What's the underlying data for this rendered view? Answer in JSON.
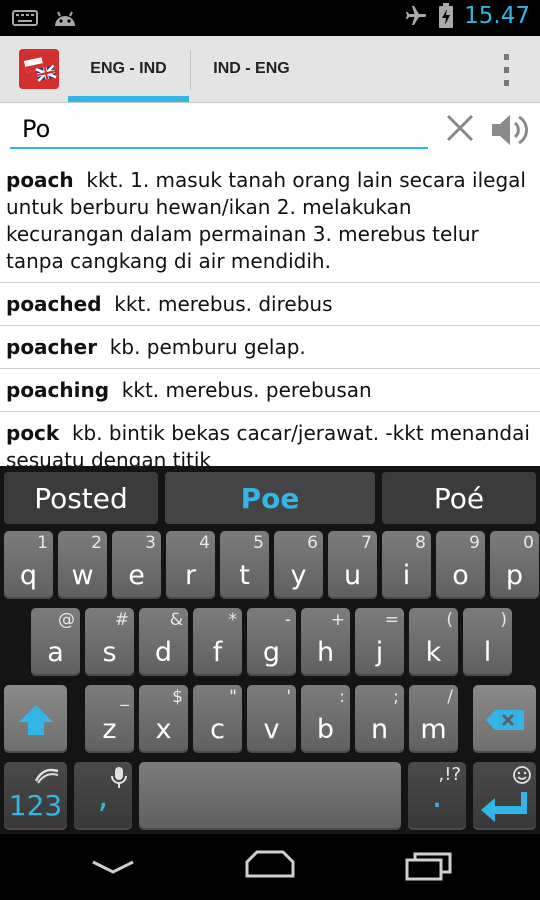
{
  "status_bar": {
    "time": "15.47",
    "icons": [
      "keyboard-icon",
      "android-debug-icon",
      "airplane-icon",
      "battery-charging-icon"
    ]
  },
  "action_bar": {
    "app_icon": "flag-uk-indonesia-icon",
    "tabs": [
      {
        "label": "ENG - IND",
        "active": true
      },
      {
        "label": "IND - ENG",
        "active": false
      }
    ],
    "overflow_icon": "more-vert-icon"
  },
  "search": {
    "value": "Po",
    "clear_icon": "close-icon",
    "speak_icon": "volume-icon"
  },
  "results": [
    {
      "word": "poach",
      "definition": "kkt. 1. masuk tanah orang lain secara ilegal untuk berburu hewan/ikan 2. melakukan kecurangan dalam permainan 3. merebus telur tanpa cangkang di air mendidih."
    },
    {
      "word": "poached",
      "definition": "kkt. merebus. direbus"
    },
    {
      "word": "poacher",
      "definition": "kb. pemburu gelap."
    },
    {
      "word": "poaching",
      "definition": "kkt. merebus. perebusan"
    },
    {
      "word": "pock",
      "definition": "kb. bintik bekas cacar/jerawat. -kkt menandai sesuatu dengan titik"
    }
  ],
  "keyboard": {
    "suggestions": [
      "Posted",
      "Poe",
      "Poé"
    ],
    "row1": [
      {
        "k": "q",
        "s": "1"
      },
      {
        "k": "w",
        "s": "2"
      },
      {
        "k": "e",
        "s": "3"
      },
      {
        "k": "r",
        "s": "4"
      },
      {
        "k": "t",
        "s": "5"
      },
      {
        "k": "y",
        "s": "6"
      },
      {
        "k": "u",
        "s": "7"
      },
      {
        "k": "i",
        "s": "8"
      },
      {
        "k": "o",
        "s": "9"
      },
      {
        "k": "p",
        "s": "0"
      }
    ],
    "row2": [
      {
        "k": "a",
        "s": "@"
      },
      {
        "k": "s",
        "s": "#"
      },
      {
        "k": "d",
        "s": "&"
      },
      {
        "k": "f",
        "s": "*"
      },
      {
        "k": "g",
        "s": "-"
      },
      {
        "k": "h",
        "s": "+"
      },
      {
        "k": "j",
        "s": "="
      },
      {
        "k": "k",
        "s": "("
      },
      {
        "k": "l",
        "s": ")"
      }
    ],
    "row3": [
      {
        "k": "z",
        "s": "_"
      },
      {
        "k": "x",
        "s": "$"
      },
      {
        "k": "c",
        "s": "\""
      },
      {
        "k": "v",
        "s": "'"
      },
      {
        "k": "b",
        "s": ":"
      },
      {
        "k": "n",
        "s": ";"
      },
      {
        "k": "m",
        "s": "/"
      }
    ],
    "numbers_label": "123",
    "comma_label": ",",
    "period_label": ".",
    "punct_label": ",!?",
    "shift_icon": "shift-icon",
    "backspace_icon": "backspace-icon",
    "mic_icon": "microphone-icon",
    "swype_icon": "swype-logo-icon",
    "emoji_icon": "smiley-icon",
    "enter_icon": "enter-icon"
  },
  "nav_bar": {
    "icons": [
      "back-icon",
      "home-icon",
      "recent-apps-icon"
    ]
  }
}
